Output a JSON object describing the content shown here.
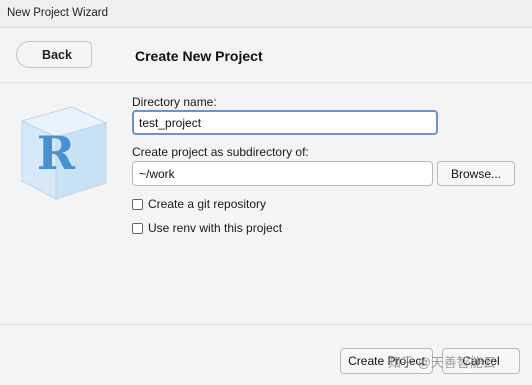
{
  "window": {
    "title": "New Project Wizard"
  },
  "header": {
    "back_label": "Back",
    "title": "Create New Project"
  },
  "form": {
    "directory_label": "Directory name:",
    "directory_value": "test_project",
    "subdir_label": "Create project as subdirectory of:",
    "subdir_value": "~/work",
    "browse_label": "Browse...",
    "git_label": "Create a git repository",
    "git_checked": false,
    "renv_label": "Use renv with this project",
    "renv_checked": false
  },
  "footer": {
    "create_label": "Create Project",
    "cancel_label": "Cancel"
  },
  "watermark": "知乎 @天善智能云",
  "colors": {
    "focus_border": "#6f93c9",
    "logo_blue": "#4a8fd0"
  }
}
